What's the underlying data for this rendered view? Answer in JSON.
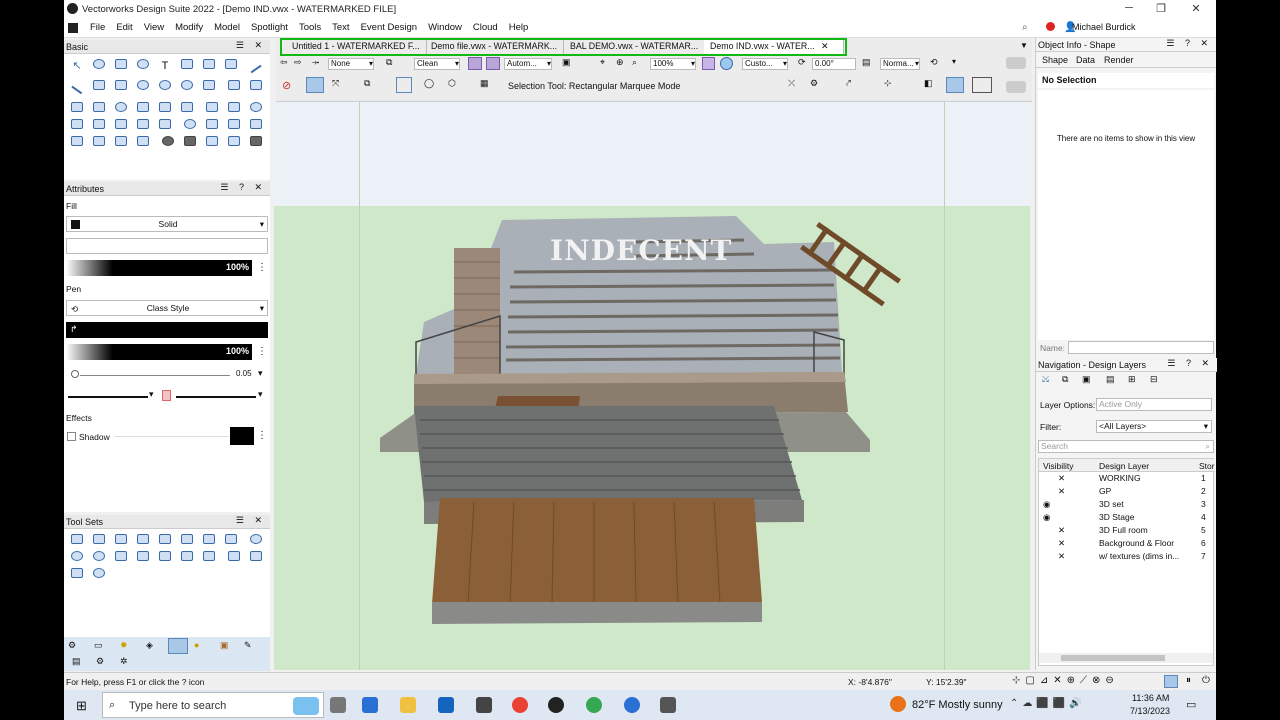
{
  "window": {
    "title": "Vectorworks Design Suite 2022 - [Demo IND.vwx - WATERMARKED FILE]"
  },
  "menu": [
    "File",
    "Edit",
    "View",
    "Modify",
    "Model",
    "Spotlight",
    "Tools",
    "Text",
    "Event Design",
    "Window",
    "Cloud",
    "Help"
  ],
  "user": "Michael Burdick",
  "panels": {
    "basic": "Basic",
    "attributes": "Attributes",
    "toolsets": "Tool Sets",
    "fill_label": "Fill",
    "fill_style": "Solid",
    "fill_opacity": "100%",
    "pen_label": "Pen",
    "pen_style": "Class Style",
    "pen_opacity": "100%",
    "line_thickness": "0.05",
    "effects_label": "Effects",
    "shadow_label": "Shadow"
  },
  "tabs": [
    "Untitled 1 - WATERMARKED F...",
    "Demo file.vwx - WATERMARK...",
    "BAL DEMO.vwx - WATERMAR...",
    "Demo IND.vwx - WATER..."
  ],
  "toolbar": {
    "class_dd": "None",
    "layer_dd": "Clean",
    "view_dd": "Autom...",
    "zoom": "100%",
    "custom_dd": "Custo...",
    "angle": "0.00°",
    "render_dd": "Norma...",
    "mode_text": "Selection Tool: Rectangular Marquee Mode"
  },
  "viewport": {
    "sign_text": "INDECENT"
  },
  "object_info": {
    "title": "Object Info - Shape",
    "tabs": [
      "Shape",
      "Data",
      "Render"
    ],
    "selection": "No Selection",
    "empty_msg": "There are no items to show in this view",
    "name_label": "Name:"
  },
  "navigation": {
    "title": "Navigation - Design Layers",
    "layer_options_label": "Layer Options:",
    "layer_options_value": "Active Only",
    "filter_label": "Filter:",
    "filter_value": "<All Layers>",
    "search_placeholder": "Search",
    "col_visibility": "Visibility",
    "col_layer": "Design Layer",
    "col_stack": "Stor",
    "layers": [
      {
        "name": "WORKING",
        "num": "1",
        "vis": "x"
      },
      {
        "name": "GP",
        "num": "2",
        "vis": "x"
      },
      {
        "name": "3D set",
        "num": "3",
        "vis": "eye"
      },
      {
        "name": "3D Stage",
        "num": "4",
        "vis": "eye"
      },
      {
        "name": "3D Full room",
        "num": "5",
        "vis": "x"
      },
      {
        "name": "Background & Floor",
        "num": "6",
        "vis": "x"
      },
      {
        "name": "w/ textures (dims in...",
        "num": "7",
        "vis": "x"
      }
    ]
  },
  "status": {
    "help": "For Help, press F1 or click the ? icon",
    "x": "X: -8'4.876\"",
    "y": "Y: 15'2.39\""
  },
  "taskbar": {
    "search_placeholder": "Type here to search",
    "weather": "82°F  Mostly sunny",
    "time": "11:36 AM",
    "date": "7/13/2023"
  },
  "colors": {
    "highlight_green": "#14b814",
    "taskbar": "#dfe8f2",
    "viewport_ground": "#cfe8ca"
  }
}
